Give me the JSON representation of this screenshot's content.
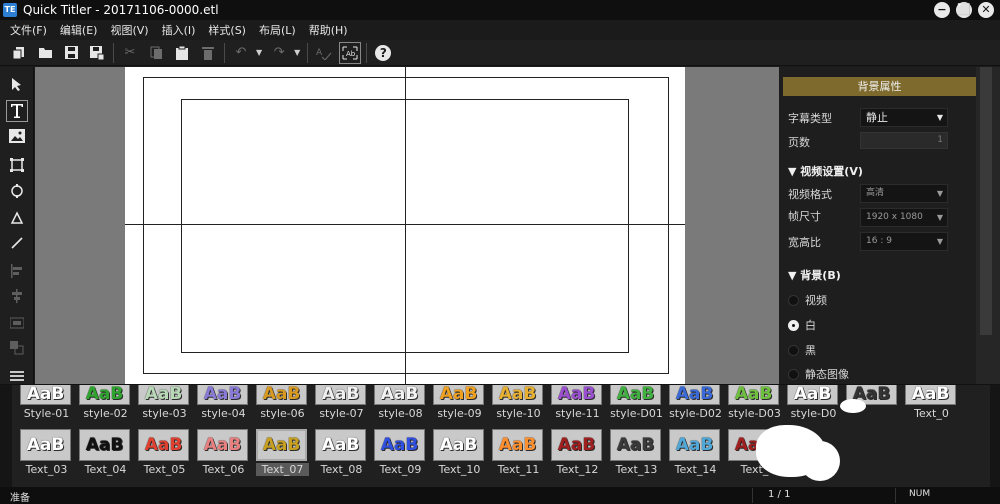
{
  "window": {
    "title": "Quick Titler - 20171106-0000.etl",
    "logo_text": "TE",
    "controls": [
      "−",
      "⬜",
      "✕"
    ]
  },
  "menu": [
    "文件(F)",
    "编辑(E)",
    "视图(V)",
    "插入(I)",
    "样式(S)",
    "布局(L)",
    "帮助(H)"
  ],
  "toolbar": {
    "icons": [
      "new-icon",
      "open-icon",
      "save-icon",
      "save-as-icon",
      "cut-icon",
      "copy-icon",
      "paste-icon",
      "delete-icon",
      "undo-icon",
      "redo-icon",
      "spellcheck-icon",
      "safe-area-icon",
      "help-icon"
    ]
  },
  "tools": {
    "icons": [
      "select-arrow-icon",
      "text-tool-icon",
      "image-tool-icon",
      "rectangle-tool-icon",
      "ellipse-tool-icon",
      "triangle-tool-icon",
      "line-tool-icon",
      "align-left-icon",
      "align-center-icon",
      "distribute-icon",
      "layer-icon",
      "more-icon"
    ]
  },
  "props": {
    "title": "背景属性",
    "caption_type_label": "字幕类型",
    "caption_type_value": "静止",
    "pages_label": "页数",
    "pages_value": "1",
    "video_settings_header": "视频设置(V)",
    "video_format_label": "视频格式",
    "video_format_value": "高清",
    "frame_size_label": "帧尺寸",
    "frame_size_value": "1920 x 1080",
    "aspect_label": "宽高比",
    "aspect_value": "16 : 9",
    "background_header": "背景(B)",
    "bg_options": [
      {
        "label": "视频",
        "selected": false
      },
      {
        "label": "白",
        "selected": true
      },
      {
        "label": "黑",
        "selected": false
      },
      {
        "label": "静态图像",
        "selected": false
      }
    ]
  },
  "gallery": {
    "sample_text": "AaB",
    "row1": [
      {
        "label": "Style-01",
        "color": "#ffffff"
      },
      {
        "label": "style-02",
        "color": "#2fa52f"
      },
      {
        "label": "style-03",
        "color": "#b8d8b8"
      },
      {
        "label": "style-04",
        "color": "#8a7ad8"
      },
      {
        "label": "style-06",
        "color": "#d89a20"
      },
      {
        "label": "style-07",
        "color": "#f0f0f0"
      },
      {
        "label": "style-08",
        "color": "#f4f4f4"
      },
      {
        "label": "style-09",
        "color": "#f0a020"
      },
      {
        "label": "style-10",
        "color": "#e8b030"
      },
      {
        "label": "style-11",
        "color": "#9a50d0"
      },
      {
        "label": "style-D01",
        "color": "#40b040"
      },
      {
        "label": "style-D02",
        "color": "#3a6ad8"
      },
      {
        "label": "style-D03",
        "color": "#70c040"
      },
      {
        "label": "style-D0",
        "color": "#ffffff"
      },
      {
        "label": "",
        "color": "#333333"
      },
      {
        "label": "Text_0",
        "color": "#ffffff"
      }
    ],
    "row2": [
      {
        "label": "Text_03",
        "color": "#ffffff",
        "selected": false
      },
      {
        "label": "Text_04",
        "color": "#111111",
        "selected": false
      },
      {
        "label": "Text_05",
        "color": "#e04030",
        "selected": false
      },
      {
        "label": "Text_06",
        "color": "#e88080",
        "selected": false
      },
      {
        "label": "Text_07",
        "color": "#c8a020",
        "selected": true
      },
      {
        "label": "Text_08",
        "color": "#ffffff",
        "selected": false
      },
      {
        "label": "Text_09",
        "color": "#3050e0",
        "selected": false
      },
      {
        "label": "Text_10",
        "color": "#ffffff",
        "selected": false
      },
      {
        "label": "Text_11",
        "color": "#ff9030",
        "selected": false
      },
      {
        "label": "Text_12",
        "color": "#a02020",
        "selected": false
      },
      {
        "label": "Text_13",
        "color": "#3a3a3a",
        "selected": false
      },
      {
        "label": "Text_14",
        "color": "#50a8d8",
        "selected": false
      },
      {
        "label": "Text_",
        "color": "#a02020",
        "selected": false
      }
    ]
  },
  "status": {
    "ready": "准备",
    "page": "1 / 1",
    "num": "NUM"
  }
}
